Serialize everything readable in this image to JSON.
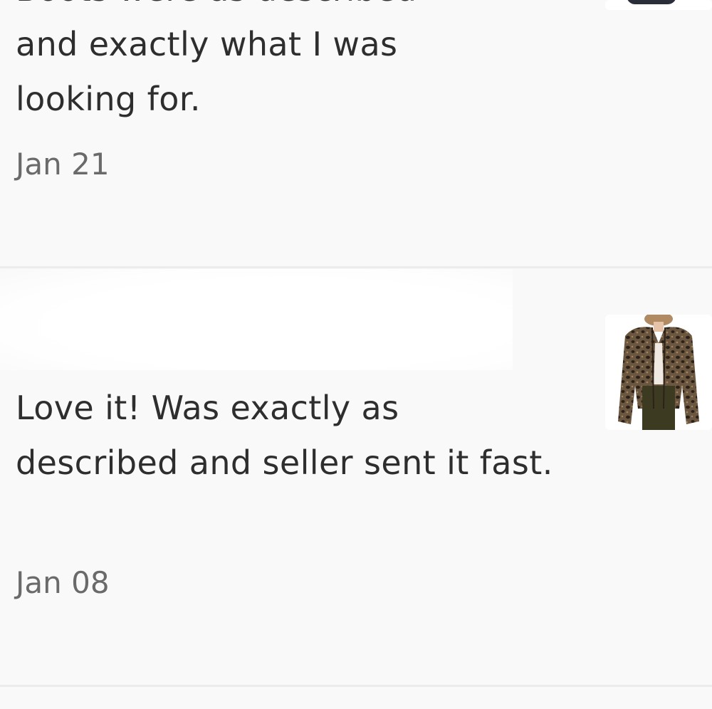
{
  "reviews": [
    {
      "cut_text": "Boots were as described",
      "text": "and exactly what I was looking for.",
      "date": "Jan 21",
      "thumbnail_icon": "boots-thumbnail"
    },
    {
      "text": "Love it! Was exactly as described and seller sent it fast.",
      "date": "Jan 08",
      "thumbnail_icon": "leopard-jacket-thumbnail"
    }
  ],
  "colors": {
    "background": "#f9f9f9",
    "divider": "#ececec",
    "text": "#2e2e2e",
    "date": "#6a6a6a"
  }
}
